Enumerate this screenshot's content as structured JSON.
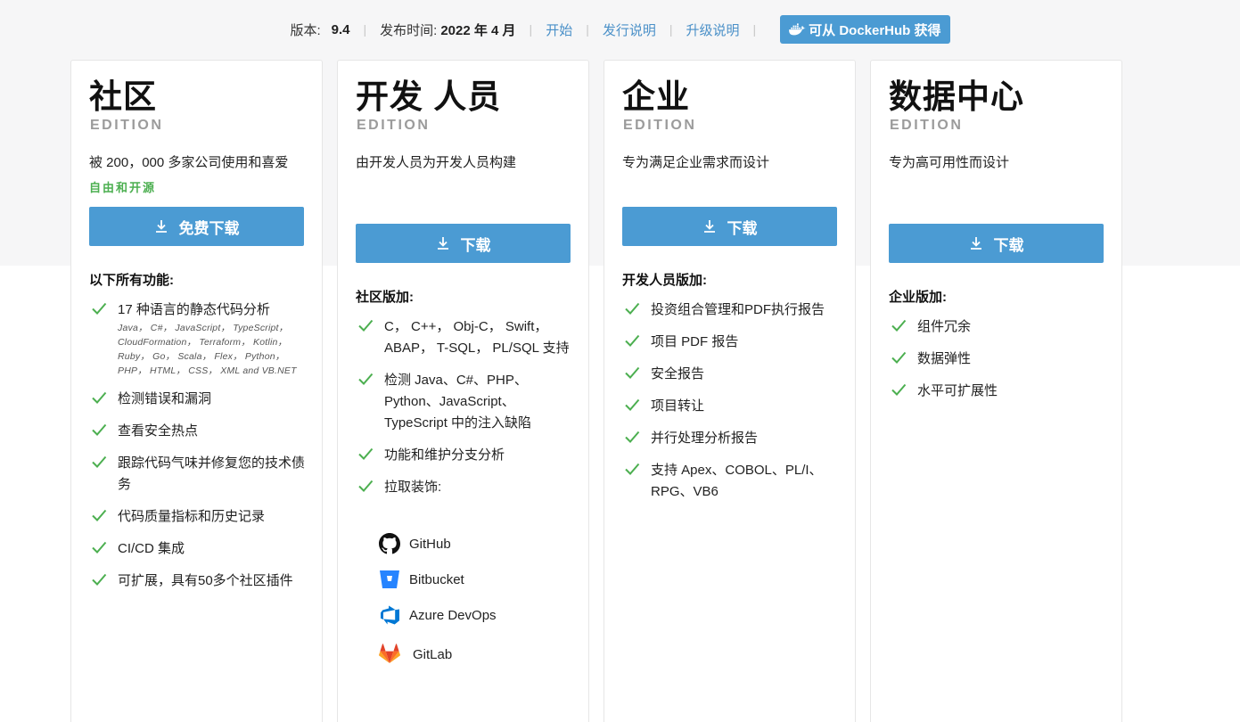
{
  "topbar": {
    "version_label": "版本:",
    "version_value": "9.4",
    "release_label": "发布时间:",
    "release_value": "2022 年 4 月",
    "links": [
      "开始",
      "发行说明",
      "升级说明"
    ],
    "docker_label": "可从 DockerHub 获得"
  },
  "colors": {
    "accent": "#4b9bd3",
    "check": "#4caf50",
    "link": "#4a90c8"
  },
  "cards": [
    {
      "title": "社区",
      "edition": "EDITION",
      "tagline": "被 200，000 多家公司使用和喜爱",
      "free_tag": "自由和开源",
      "button": "免费下载",
      "section": "以下所有功能:",
      "features": [
        "17 种语言的静态代码分析",
        "检测错误和漏洞",
        "查看安全热点",
        "跟踪代码气味并修复您的技术债务",
        "代码质量指标和历史记录",
        "CI/CD 集成",
        "可扩展，具有50多个社区插件"
      ],
      "languages_note": "Java， C#， JavaScript， TypeScript， CloudFormation， Terraform， Kotlin， Ruby， Go， Scala， Flex， Python， PHP， HTML， CSS， XML and VB.NET"
    },
    {
      "title": "开发 人员",
      "edition": "EDITION",
      "tagline": "由开发人员为开发人员构建",
      "button": "下载",
      "section": "社区版加:",
      "features": [
        "C， C++， Obj-C， Swift， ABAP， T-SQL， PL/SQL 支持",
        "检测 Java、C#、PHP、Python、JavaScript、TypeScript 中的注入缺陷",
        "功能和维护分支分析",
        "拉取装饰:"
      ],
      "integrations": [
        {
          "name": "GitHub",
          "icon": "github-icon"
        },
        {
          "name": "Bitbucket",
          "icon": "bitbucket-icon"
        },
        {
          "name": "Azure DevOps",
          "icon": "azure-devops-icon"
        },
        {
          "name": "GitLab",
          "icon": "gitlab-icon"
        }
      ]
    },
    {
      "title": "企业",
      "edition": "EDITION",
      "tagline": "专为满足企业需求而设计",
      "button": "下载",
      "section": "开发人员版加:",
      "features": [
        "投资组合管理和PDF执行报告",
        "项目 PDF 报告",
        "安全报告",
        "项目转让",
        "并行处理分析报告",
        "支持 Apex、COBOL、PL/I、RPG、VB6"
      ]
    },
    {
      "title": "数据中心",
      "edition": "EDITION",
      "tagline": "专为高可用性而设计",
      "button": "下载",
      "section": "企业版加:",
      "features": [
        "组件冗余",
        "数据弹性",
        "水平可扩展性"
      ]
    }
  ]
}
